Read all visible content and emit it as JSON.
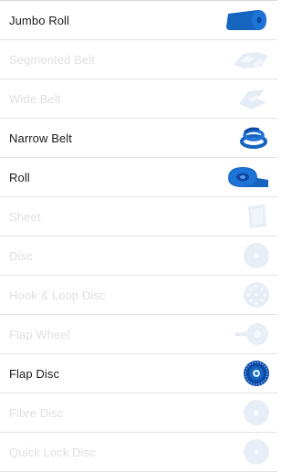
{
  "colors": {
    "active_text": "#1a1a1a",
    "inactive_text": "#e0e0e0",
    "accent_blue": "#1565c0",
    "faded_blue": "#e8eef6",
    "divider": "#e3e3e3"
  },
  "items": [
    {
      "label": "Jumbo Roll",
      "active": true,
      "icon": "jumbo-roll-icon"
    },
    {
      "label": "Segmented Belt",
      "active": false,
      "icon": "segmented-belt-icon"
    },
    {
      "label": "Wide Belt",
      "active": false,
      "icon": "wide-belt-icon"
    },
    {
      "label": "Narrow Belt",
      "active": true,
      "icon": "narrow-belt-icon"
    },
    {
      "label": "Roll",
      "active": true,
      "icon": "roll-icon"
    },
    {
      "label": "Sheet",
      "active": false,
      "icon": "sheet-icon"
    },
    {
      "label": "Disc",
      "active": false,
      "icon": "disc-icon"
    },
    {
      "label": "Hook & Loop Disc",
      "active": false,
      "icon": "hook-loop-disc-icon"
    },
    {
      "label": "Flap Wheel",
      "active": false,
      "icon": "flap-wheel-icon"
    },
    {
      "label": "Flap Disc",
      "active": true,
      "icon": "flap-disc-icon"
    },
    {
      "label": "Fibre Disc",
      "active": false,
      "icon": "fibre-disc-icon"
    },
    {
      "label": "Quick Lock Disc",
      "active": false,
      "icon": "quick-lock-disc-icon"
    }
  ]
}
